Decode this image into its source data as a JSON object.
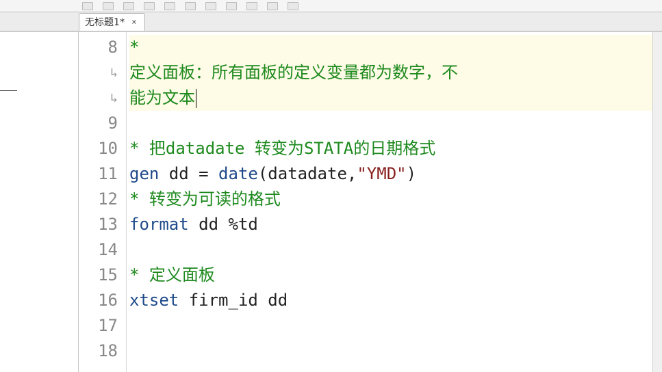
{
  "tab": {
    "label": "无标题1*"
  },
  "gutter": [
    "8",
    "↳",
    "↳",
    "9",
    "10",
    "11",
    "12",
    "13",
    "14",
    "15",
    "16",
    "17",
    "18"
  ],
  "code": {
    "l8": "*",
    "l8w1": "定义面板：所有面板的定义变量都为数字，不",
    "l8w2": "能为文本",
    "l10_star": "* ",
    "l10_text1": "把",
    "l10_text2": "datadate ",
    "l10_text3": "转变为",
    "l10_text4": "STATA",
    "l10_text5": "的日期格式",
    "l11_gen": "gen ",
    "l11_dd_eq": "dd = ",
    "l11_date": "date",
    "l11_paren1": "(datadate,",
    "l11_str": "\"YMD\"",
    "l11_paren2": ")",
    "l12_star": "* ",
    "l12_text": "转变为可读的格式",
    "l13_format": "format ",
    "l13_rest": "dd %td",
    "l15_star": "* ",
    "l15_text": "定义面板",
    "l16_xtset": "xtset ",
    "l16_rest": "firm_id dd"
  }
}
